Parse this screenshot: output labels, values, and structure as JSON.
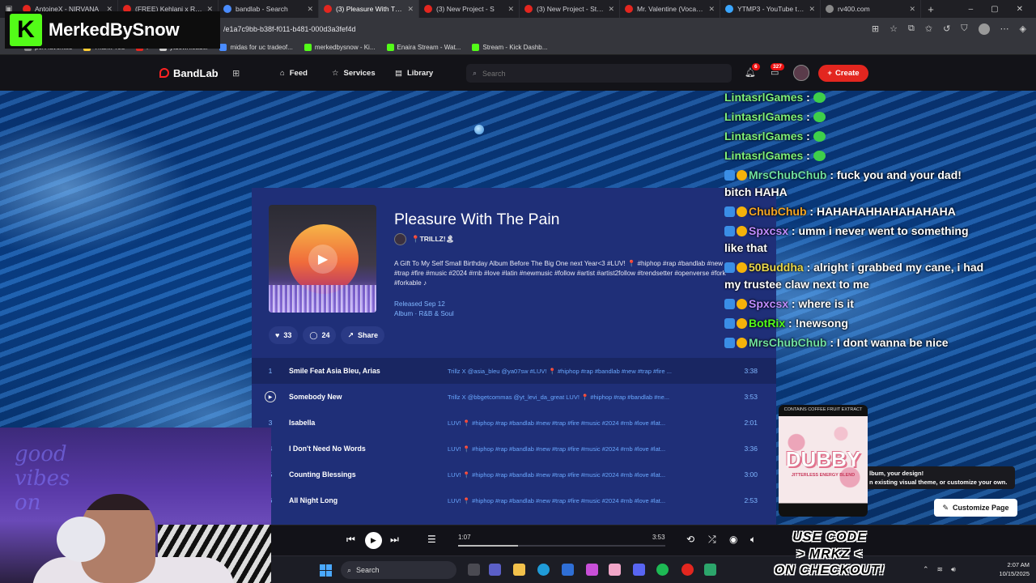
{
  "browser": {
    "tabs": [
      {
        "title": "AntoineX - NIRVANA",
        "color": "#e3261f"
      },
      {
        "title": "(FREE) Kehlani x R&B T",
        "color": "#e3261f"
      },
      {
        "title": "bandlab - Search",
        "color": "#4a8cff"
      },
      {
        "title": "(3) Pleasure With The P",
        "color": "#e3261f"
      },
      {
        "title": "(3) New Project - S",
        "color": "#e3261f"
      },
      {
        "title": "(3) New Project - Studio",
        "color": "#e3261f"
      },
      {
        "title": "Mr. Valentine (Vocals C",
        "color": "#e3261f"
      },
      {
        "title": "YTMP3 - YouTube to M",
        "color": "#3aa6ff"
      },
      {
        "title": "rv400.com",
        "color": "#888"
      }
    ],
    "url": "/e1a7c9bb-b38f-f011-b481-000d3a3fef4d",
    "bookmarks": [
      "port favorites",
      "Thank You",
      "i",
      "ytdownloader",
      "midas for uc tradeof...",
      "merkedbysnow - Ki...",
      "Enaira Stream - Wat...",
      "Stream - Kick Dashb..."
    ]
  },
  "overlay": {
    "logo_letter": "K",
    "logo_text": "MerkedBySnow",
    "promo_lines": [
      "USE CODE",
      "> MRKZ <",
      "ON CHECKOUT!"
    ]
  },
  "nav": {
    "brand": "BandLab",
    "feed": "Feed",
    "services": "Services",
    "library": "Library",
    "search_placeholder": "Search",
    "notif_count": "6",
    "msg_count": "327",
    "create": "Create"
  },
  "album": {
    "title": "Pleasure With The Pain",
    "artist": "📍TRILLZ!🏝",
    "description": "A Gift To My Self Small Birthday Album Before The Big One next Year<3 #LUV! 📍 #hiphop #rap #bandlab #new #trap #fire #music #2024 #rnb #love #latin #newmusic #follow #artist #artist2follow #trendsetter #openverse #fork #forkable ♪",
    "released": "Released Sep 12",
    "genre": "Album · R&B & Soul",
    "likes": "33",
    "comments": "24",
    "share": "Share",
    "tracks": [
      {
        "num": "1",
        "name": "Smile Feat Asia Bleu, Arias",
        "desc": "Trillz X @asia_bleu @ya07sw #LUV! 📍 #hiphop #rap #bandlab #new #trap #fire ...",
        "dur": "3:38"
      },
      {
        "num": "",
        "name": "Somebody New",
        "desc": "Trillz X @bbgetcommas @yt_levi_da_great LUV! 📍 #hiphop #rap #bandlab #ne...",
        "dur": "3:53"
      },
      {
        "num": "3",
        "name": "Isabella",
        "desc": "LUV! 📍 #hiphop #rap #bandlab #new #trap #fire #music #2024 #rnb #love #lat...",
        "dur": "2:01"
      },
      {
        "num": "4",
        "name": "I Don't Need No Words",
        "desc": "LUV! 📍 #hiphop #rap #bandlab #new #trap #fire #music #2024 #rnb #love #lat...",
        "dur": "3:36"
      },
      {
        "num": "5",
        "name": "Counting Blessings",
        "desc": "LUV! 📍 #hiphop #rap #bandlab #new #trap #fire #music #2024 #rnb #love #lat...",
        "dur": "3:00"
      },
      {
        "num": "6",
        "name": "All Night Long",
        "desc": "LUV! 📍 #hiphop #rap #bandlab #new #trap #fire #music #2024 #rnb #love #lat...",
        "dur": "2:53"
      }
    ]
  },
  "chat": [
    {
      "user": "LintasrlGames",
      "color": "#7ef07a",
      "text": "",
      "emote": true
    },
    {
      "user": "LintasrlGames",
      "color": "#7ef07a",
      "text": "",
      "emote": true
    },
    {
      "user": "LintasrlGames",
      "color": "#7ef07a",
      "text": "",
      "emote": true
    },
    {
      "user": "LintasrlGames",
      "color": "#7ef07a",
      "text": "",
      "emote": true
    },
    {
      "user": "MrsChubChub",
      "color": "#6fe0a0",
      "text": "fuck you and your dad! bitch HAHA"
    },
    {
      "user": "ChubChub",
      "color": "#f5a623",
      "text": "HAHAHAHHAHAHAHAHA"
    },
    {
      "user": "Spxcsx",
      "color": "#c08cff",
      "text": "umm i never went to something like that"
    },
    {
      "user": "50Buddha",
      "color": "#e9d74a",
      "text": "alright i grabbed my cane, i had my trustee claw next to me"
    },
    {
      "user": "Spxcsx",
      "color": "#c08cff",
      "text": "where is it"
    },
    {
      "user": "BotRix",
      "color": "#53fc18",
      "text": "!newsong"
    },
    {
      "user": "MrsChubChub",
      "color": "#6fe0a0",
      "text": "I dont wanna be nice"
    }
  ],
  "product": {
    "top_text": "CONTAINS COFFEE FRUIT EXTRACT",
    "name": "DUBBY",
    "sub": "JITTERLESS ENERGY BLEND"
  },
  "customize": {
    "tooltip_line1": "lbum, your design!",
    "tooltip_line2": "n existing visual theme, or customize your own.",
    "button": "Customize Page"
  },
  "player": {
    "elapsed": "1:07",
    "total": "3:53",
    "progress": 0.29
  },
  "taskbar": {
    "search": "Search",
    "time": "2:07 AM",
    "date": "10/15/2025"
  }
}
